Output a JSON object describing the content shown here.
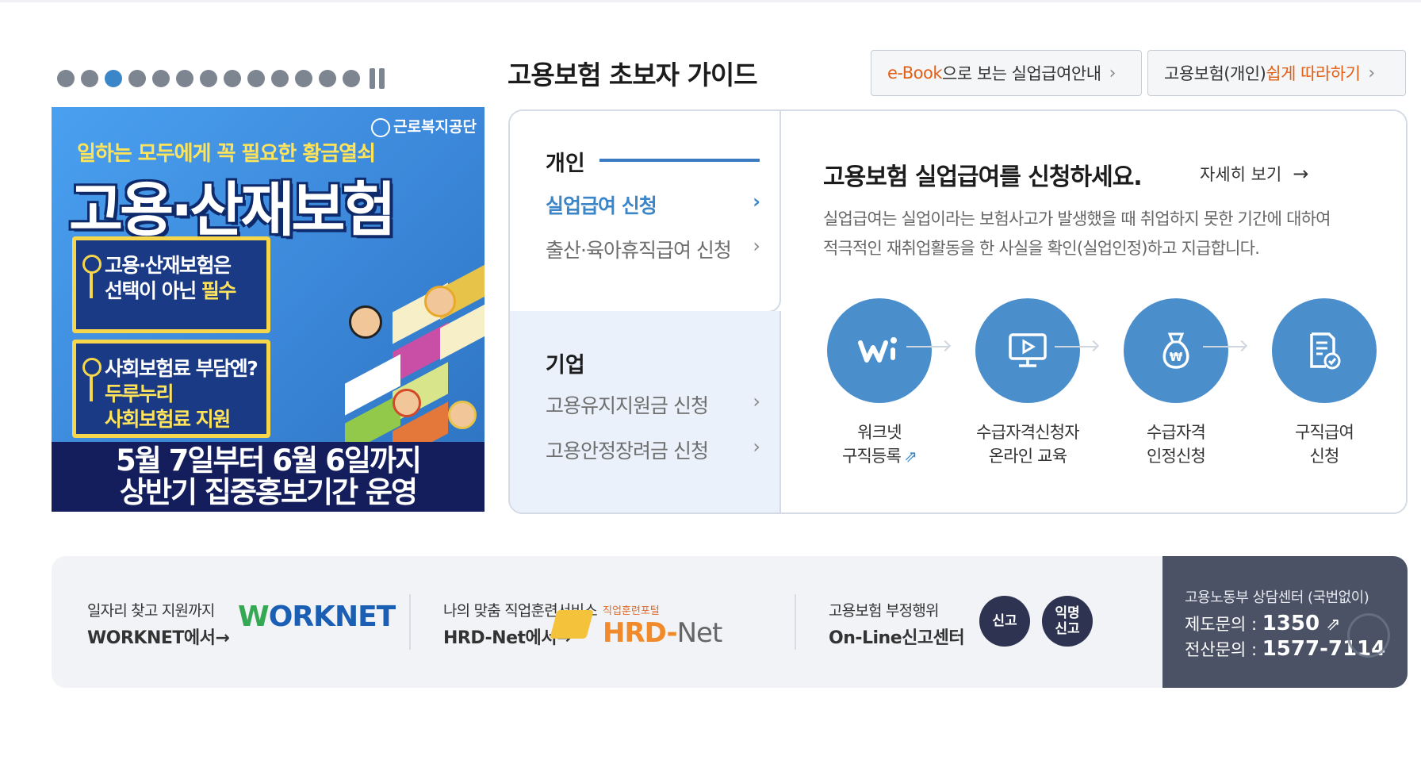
{
  "banner": {
    "dot_count": 13,
    "active_dot": 3,
    "agency": "근로복지공단",
    "subtitle": "일하는 모두에게 꼭 필요한 황금열쇠",
    "title": "고용·산재보험",
    "card1_line1": "고용·산재보험은",
    "card1_line2a": "선택이 아닌 ",
    "card1_line2b": "필수",
    "card2_line1": "사회보험료 부담엔?",
    "card2_line2": "두루누리",
    "card2_line3": "사회보험료 지원",
    "bottom_line1": "5월 7일부터 6월 6일까지",
    "bottom_line2": "상반기 집중홍보기간 운영"
  },
  "guide": {
    "title": "고용보험 초보자 가이드",
    "btn_ebook_highlight": "e-Book",
    "btn_ebook_rest": "으로 보는 실업급여안내",
    "btn_follow_plain": "고용보험(개인) ",
    "btn_follow_highlight": "쉽게 따라하기",
    "personal": {
      "head": "개인",
      "items": [
        "실업급여 신청",
        "출산·육아휴직급여 신청"
      ]
    },
    "company": {
      "head": "기업",
      "items": [
        "고용유지지원금 신청",
        "고용안정장려금 신청"
      ]
    },
    "detail": {
      "title": "고용보험 실업급여를 신청하세요.",
      "more": "자세히 보기",
      "desc_line1": "실업급여는 실업이라는 보험사고가 발생했을 때 취업하지 못한 기간에 대하여",
      "desc_line2": "적극적인 재취업활동을 한 사실을 확인(실업인정)하고 지급합니다.",
      "steps": [
        {
          "l1": "워크넷",
          "l2": "구직등록",
          "icon": "worknet-icon"
        },
        {
          "l1": "수급자격신청자",
          "l2": "온라인 교육",
          "icon": "monitor-icon"
        },
        {
          "l1": "수급자격",
          "l2": "인정신청",
          "icon": "money-bag-icon"
        },
        {
          "l1": "구직급여",
          "l2": "신청",
          "icon": "document-check-icon"
        }
      ]
    }
  },
  "bottom": {
    "worknet_small": "일자리 찾고 지원까지",
    "worknet_big": "WORKNET에서→",
    "worknet_logo_w": "W",
    "worknet_logo_rest": "ORKNET",
    "hrd_small": "나의 맞춤 직업훈련서비스",
    "hrd_big": "HRD-Net에서→",
    "hrd_logo_small": "직업훈련포털",
    "hrd_logo_main": "HRD-",
    "hrd_logo_net": "Net",
    "report_small": "고용보험 부정행위",
    "report_big": "On-Line신고센터",
    "report_btn": "신고",
    "anon_btn_line1": "익명",
    "anon_btn_line2": "신고",
    "call_title": "고용노동부 상담센터 (국번없이)",
    "call_line1_label": "제도문의 : ",
    "call_line1_num": "1350",
    "call_line2_label": "전산문의 : ",
    "call_line2_num": "1577-7114"
  }
}
